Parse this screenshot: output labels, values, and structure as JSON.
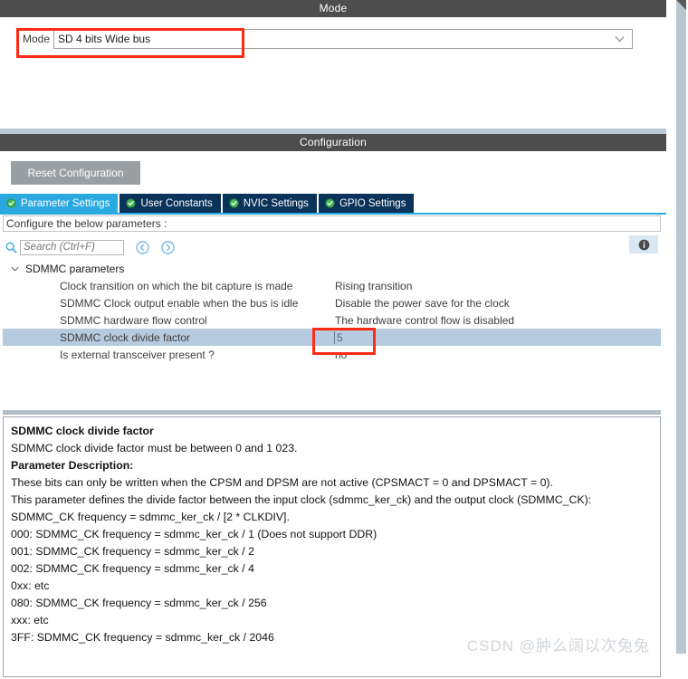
{
  "mode_section": {
    "header": "Mode",
    "field_label": "Mode",
    "selected_value": "SD 4 bits Wide bus",
    "chevron_icon": "chevron-down-icon"
  },
  "configuration_section": {
    "header": "Configuration",
    "reset_button": "Reset Configuration",
    "tabs": [
      {
        "label": "Parameter Settings",
        "active": true,
        "icon": "check-circle-icon"
      },
      {
        "label": "User Constants",
        "active": false,
        "icon": "check-circle-icon"
      },
      {
        "label": "NVIC Settings",
        "active": false,
        "icon": "check-circle-icon"
      },
      {
        "label": "GPIO Settings",
        "active": false,
        "icon": "check-circle-icon"
      }
    ],
    "configure_hint": "Configure the below parameters :",
    "search": {
      "placeholder": "Search (Ctrl+F)",
      "value": "",
      "icon": "search-icon"
    },
    "nav_back_icon": "circle-left-arrow-icon",
    "nav_forward_icon": "circle-right-arrow-icon",
    "info_icon": "info-icon"
  },
  "parameter_tree": {
    "group_label": "SDMMC parameters",
    "group_expanded_icon": "chevron-down-icon",
    "rows": [
      {
        "name": "Clock transition on which the bit capture is made",
        "value": "Rising transition",
        "selected": false,
        "editing": false
      },
      {
        "name": "SDMMC Clock output enable when the bus is idle",
        "value": "Disable the power save for the clock",
        "selected": false,
        "editing": false
      },
      {
        "name": "SDMMC hardware flow control",
        "value": "The hardware control flow is disabled",
        "selected": false,
        "editing": false
      },
      {
        "name": "SDMMC clock divide factor",
        "value": "5",
        "selected": true,
        "editing": true
      },
      {
        "name": "Is external transceiver present ?",
        "value": "no",
        "selected": false,
        "editing": false
      }
    ]
  },
  "description": {
    "lines": [
      {
        "text": "SDMMC clock divide factor",
        "bold": true
      },
      {
        "text": "SDMMC clock divide factor must be between 0 and 1 023.",
        "bold": false
      },
      {
        "text": "Parameter Description:",
        "bold": true
      },
      {
        "text": "These bits can only be written when the CPSM and DPSM are not active (CPSMACT = 0 and DPSMACT = 0).",
        "bold": false
      },
      {
        "text": "This parameter defines the divide factor between the input clock (sdmmc_ker_ck) and the output clock (SDMMC_CK):",
        "bold": false
      },
      {
        "text": "SDMMC_CK frequency = sdmmc_ker_ck / [2 * CLKDIV].",
        "bold": false
      },
      {
        "text": "000: SDMMC_CK frequency = sdmmc_ker_ck / 1 (Does not support DDR)",
        "bold": false
      },
      {
        "text": "001: SDMMC_CK frequency = sdmmc_ker_ck / 2",
        "bold": false
      },
      {
        "text": "002: SDMMC_CK frequency = sdmmc_ker_ck / 4",
        "bold": false
      },
      {
        "text": "0xx: etc",
        "bold": false
      },
      {
        "text": "080: SDMMC_CK frequency = sdmmc_ker_ck / 256",
        "bold": false
      },
      {
        "text": "xxx: etc",
        "bold": false
      },
      {
        "text": "3FF: SDMMC_CK frequency = sdmmc_ker_ck / 2046",
        "bold": false
      }
    ]
  },
  "watermark": {
    "text": "CSDN @肿么阔以次兔兔"
  },
  "colors": {
    "header_bar": "#4d4d4d",
    "tab_active": "#2aa9e0",
    "tab_inactive": "#0b3258",
    "row_selected": "#b6cbe0",
    "annotation": "#fc2b14",
    "scrollbar": "#b9c7d0"
  }
}
